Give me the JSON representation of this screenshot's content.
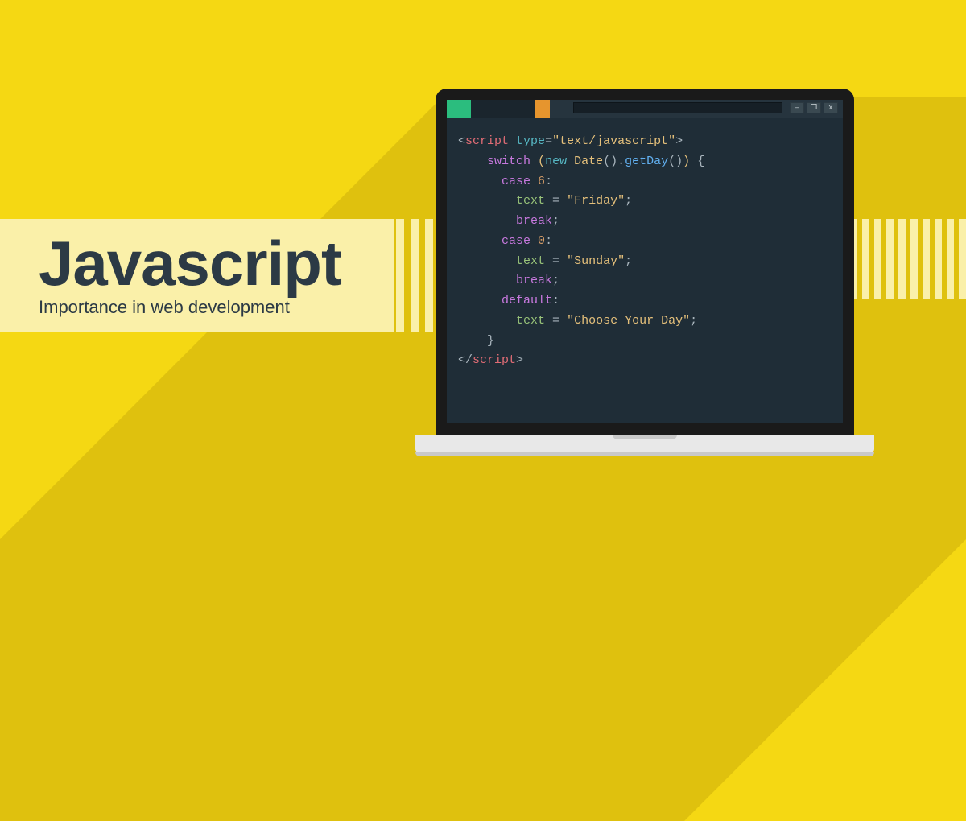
{
  "title": "Javascript",
  "subtitle": "Importance in web development",
  "code": {
    "scriptOpen1": "<",
    "scriptTag": "script",
    "attrName": "type",
    "attrVal": "\"text/javascript\"",
    "scriptOpen2": ">",
    "switchKw": "switch",
    "newKw": "new",
    "dateClass": "Date",
    "getDay": "getDay",
    "case6": "case",
    "num6": "6",
    "textVar": "text",
    "friday": "\"Friday\"",
    "breakKw": "break",
    "case0": "case",
    "num0": "0",
    "sunday": "\"Sunday\"",
    "defaultKw": "default",
    "chooseDay": "\"Choose Your Day\"",
    "scriptCloseTag": "script"
  },
  "windowButtons": {
    "min": "—",
    "max": "❐",
    "close": "x"
  }
}
